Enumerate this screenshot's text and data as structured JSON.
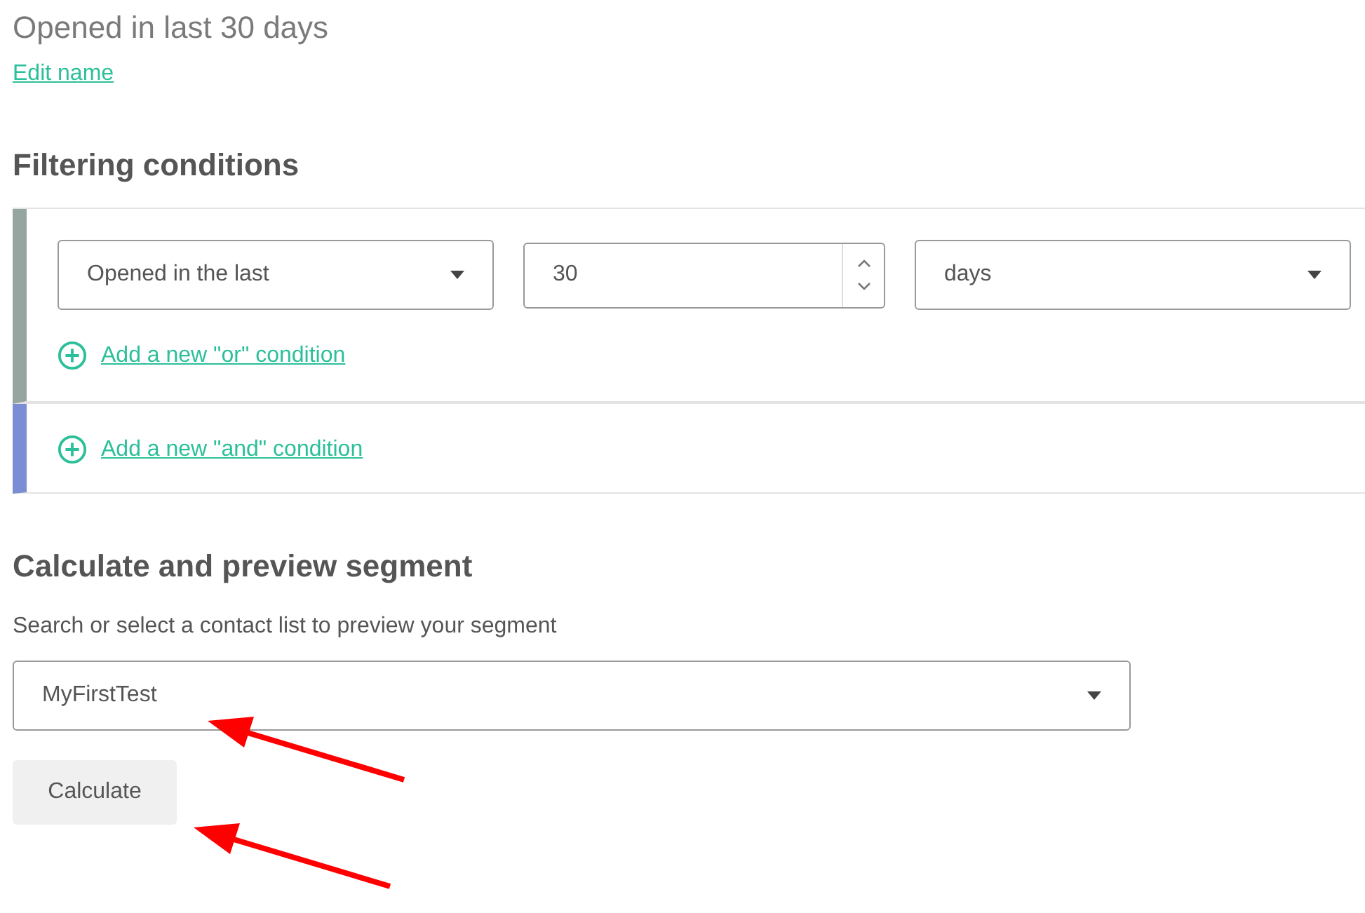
{
  "segment_title": "Opened in last 30 days",
  "edit_link": "Edit name",
  "filtering": {
    "heading": "Filtering conditions",
    "groups": [
      {
        "color": "#95a59f",
        "conditions": [
          {
            "field": "Opened in the last",
            "value": "30",
            "unit": "days"
          }
        ],
        "add_link": "Add a new \"or\" condition"
      },
      {
        "color": "#7b8dd3",
        "add_link": "Add a new \"and\" condition"
      }
    ]
  },
  "preview": {
    "heading": "Calculate and preview segment",
    "label": "Search or select a contact list to preview your segment",
    "list_select": "MyFirstTest",
    "button": "Calculate"
  }
}
